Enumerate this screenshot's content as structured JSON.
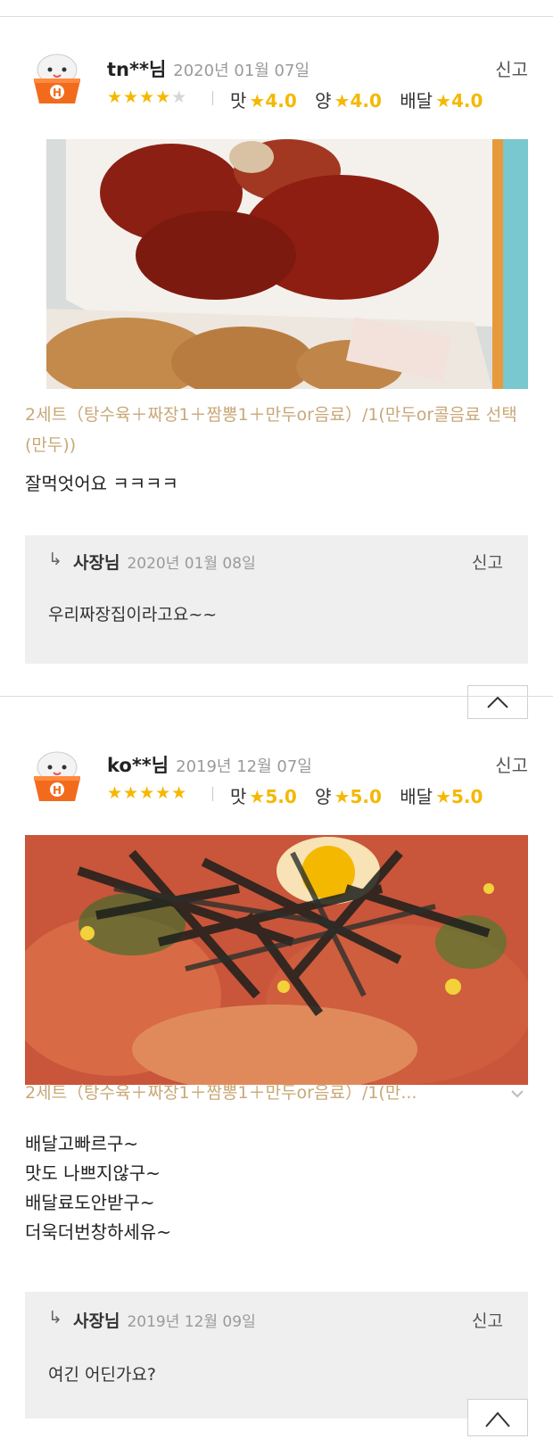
{
  "reviews": [
    {
      "user": "tn**님",
      "date": "2020년 01월 07일",
      "report": "신고",
      "stars_filled": "★★★★",
      "stars_empty": "★",
      "rating": 4,
      "scores": {
        "taste_label": "맛",
        "taste": "★4.0",
        "qty_label": "양",
        "qty": "★4.0",
        "delivery_label": "배달",
        "delivery": "★4.0"
      },
      "menu": "2세트（탕수육＋짜장1＋짬뽕1＋만두or음료）/1(만두or콜음료 선택(만두))",
      "comment": "잘먹엇어요 ㅋㅋㅋㅋ",
      "reply": {
        "arrow": "↳",
        "owner": "사장님",
        "date": "2020년 01월 08일",
        "report": "신고",
        "text": "우리짜장집이라고요~~"
      }
    },
    {
      "user": "ko**님",
      "date": "2019년 12월 07일",
      "report": "신고",
      "stars_filled": "★★★★★",
      "stars_empty": "",
      "rating": 5,
      "scores": {
        "taste_label": "맛",
        "taste": "★5.0",
        "qty_label": "양",
        "qty": "★5.0",
        "delivery_label": "배달",
        "delivery": "★5.0"
      },
      "menu": "2세트（탕수육＋짜장1＋짬뽕1＋만두or음료）/1(만...",
      "comment": "배달고빠르구~\n맛도 나쁘지않구~\n배달료도안받구~\n더욱더번창하세유~",
      "reply": {
        "arrow": "↳",
        "owner": "사장님",
        "date": "2019년 12월 09일",
        "report": "신고",
        "text": "여긴 어딘가요?"
      }
    }
  ],
  "icons": {
    "avatar": "mascot-icon",
    "scroll_top": "arrow-up-icon",
    "expand": "chevron-down-icon"
  },
  "colors": {
    "star": "#f5b800",
    "menu": "#c8a877",
    "reply_bg": "#efefef"
  }
}
